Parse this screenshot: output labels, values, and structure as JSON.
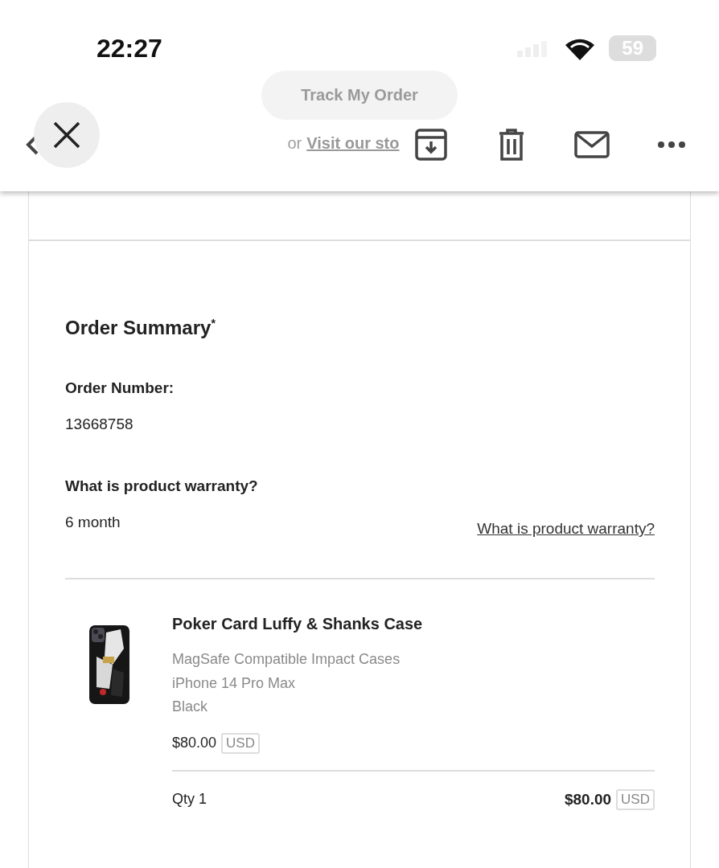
{
  "status_bar": {
    "time": "22:27",
    "battery": "59"
  },
  "email_behind": {
    "button": "Track My Order",
    "prefix": "or",
    "link": "Visit our sto"
  },
  "order_summary": {
    "title": "Order Summary$^{*}$",
    "number_label": "Order Number:",
    "number": "13668758",
    "warranty_label": "What is product warranty?",
    "warranty": "6 month",
    "warranty_link": "What is product warranty?"
  },
  "item": {
    "name": "Poker Card Luffy & Shanks Case",
    "details": [
      "MagSafe Compatible Impact Cases",
      "iPhone 14 Pro Max",
      "Black"
    ],
    "price": "$80.00",
    "currency": "USD",
    "qty": "Qty 1",
    "total": "$80.00",
    "total_currency": "USD"
  }
}
